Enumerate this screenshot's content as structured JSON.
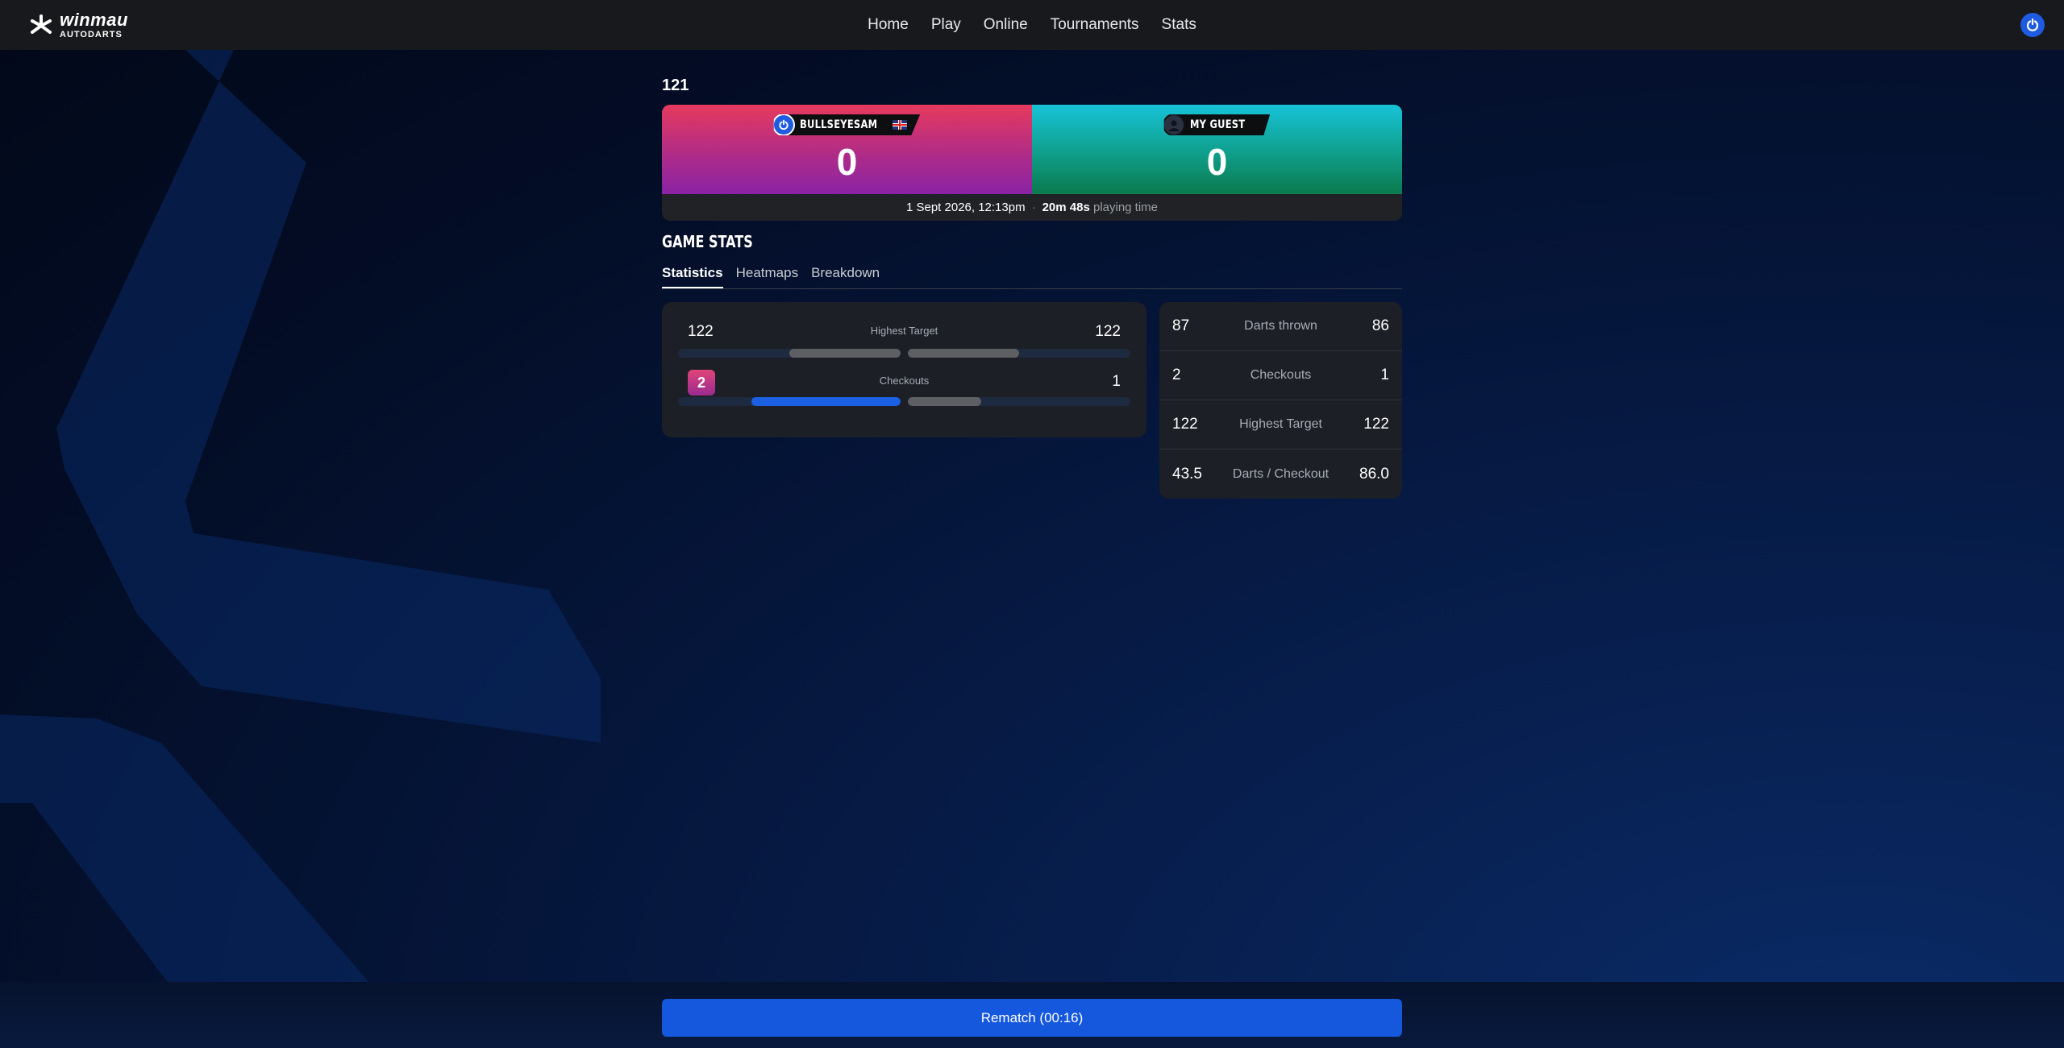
{
  "brand": {
    "line1": "winmau",
    "line2": "AUTODARTS"
  },
  "nav": {
    "items": [
      "Home",
      "Play",
      "Online",
      "Tournaments",
      "Stats"
    ]
  },
  "match": {
    "title": "121",
    "players": [
      {
        "name": "BULLSEYESAM",
        "score": "0",
        "flag": "GB"
      },
      {
        "name": "MY GUEST",
        "score": "0"
      }
    ],
    "date": "1 Sept 2026, 12:13pm",
    "duration": "20m 48s",
    "duration_suffix": "playing time"
  },
  "section_title": "GAME STATS",
  "tabs": [
    "Statistics",
    "Heatmaps",
    "Breakdown"
  ],
  "active_tab": "Statistics",
  "comparison": [
    {
      "label": "Highest Target",
      "left": "122",
      "right": "122",
      "left_fraction": 0.5,
      "right_fraction": 0.5,
      "left_color": "#5d5f63",
      "right_color": "#5d5f63"
    },
    {
      "label": "Checkouts",
      "left": "2",
      "right": "1",
      "left_fraction": 0.67,
      "right_fraction": 0.33,
      "left_color": "#1b5fe3",
      "right_color": "#5d5f63"
    }
  ],
  "summary": [
    {
      "left": "87",
      "label": "Darts thrown",
      "right": "86"
    },
    {
      "left": "2",
      "label": "Checkouts",
      "right": "1"
    },
    {
      "left": "122",
      "label": "Highest Target",
      "right": "122"
    },
    {
      "left": "43.5",
      "label": "Darts / Checkout",
      "right": "86.0"
    }
  ],
  "rematch_label": "Rematch (00:16)",
  "colors": {
    "accent": "#1557dd",
    "player1": "#e63a5d",
    "player2": "#17c3d8"
  }
}
